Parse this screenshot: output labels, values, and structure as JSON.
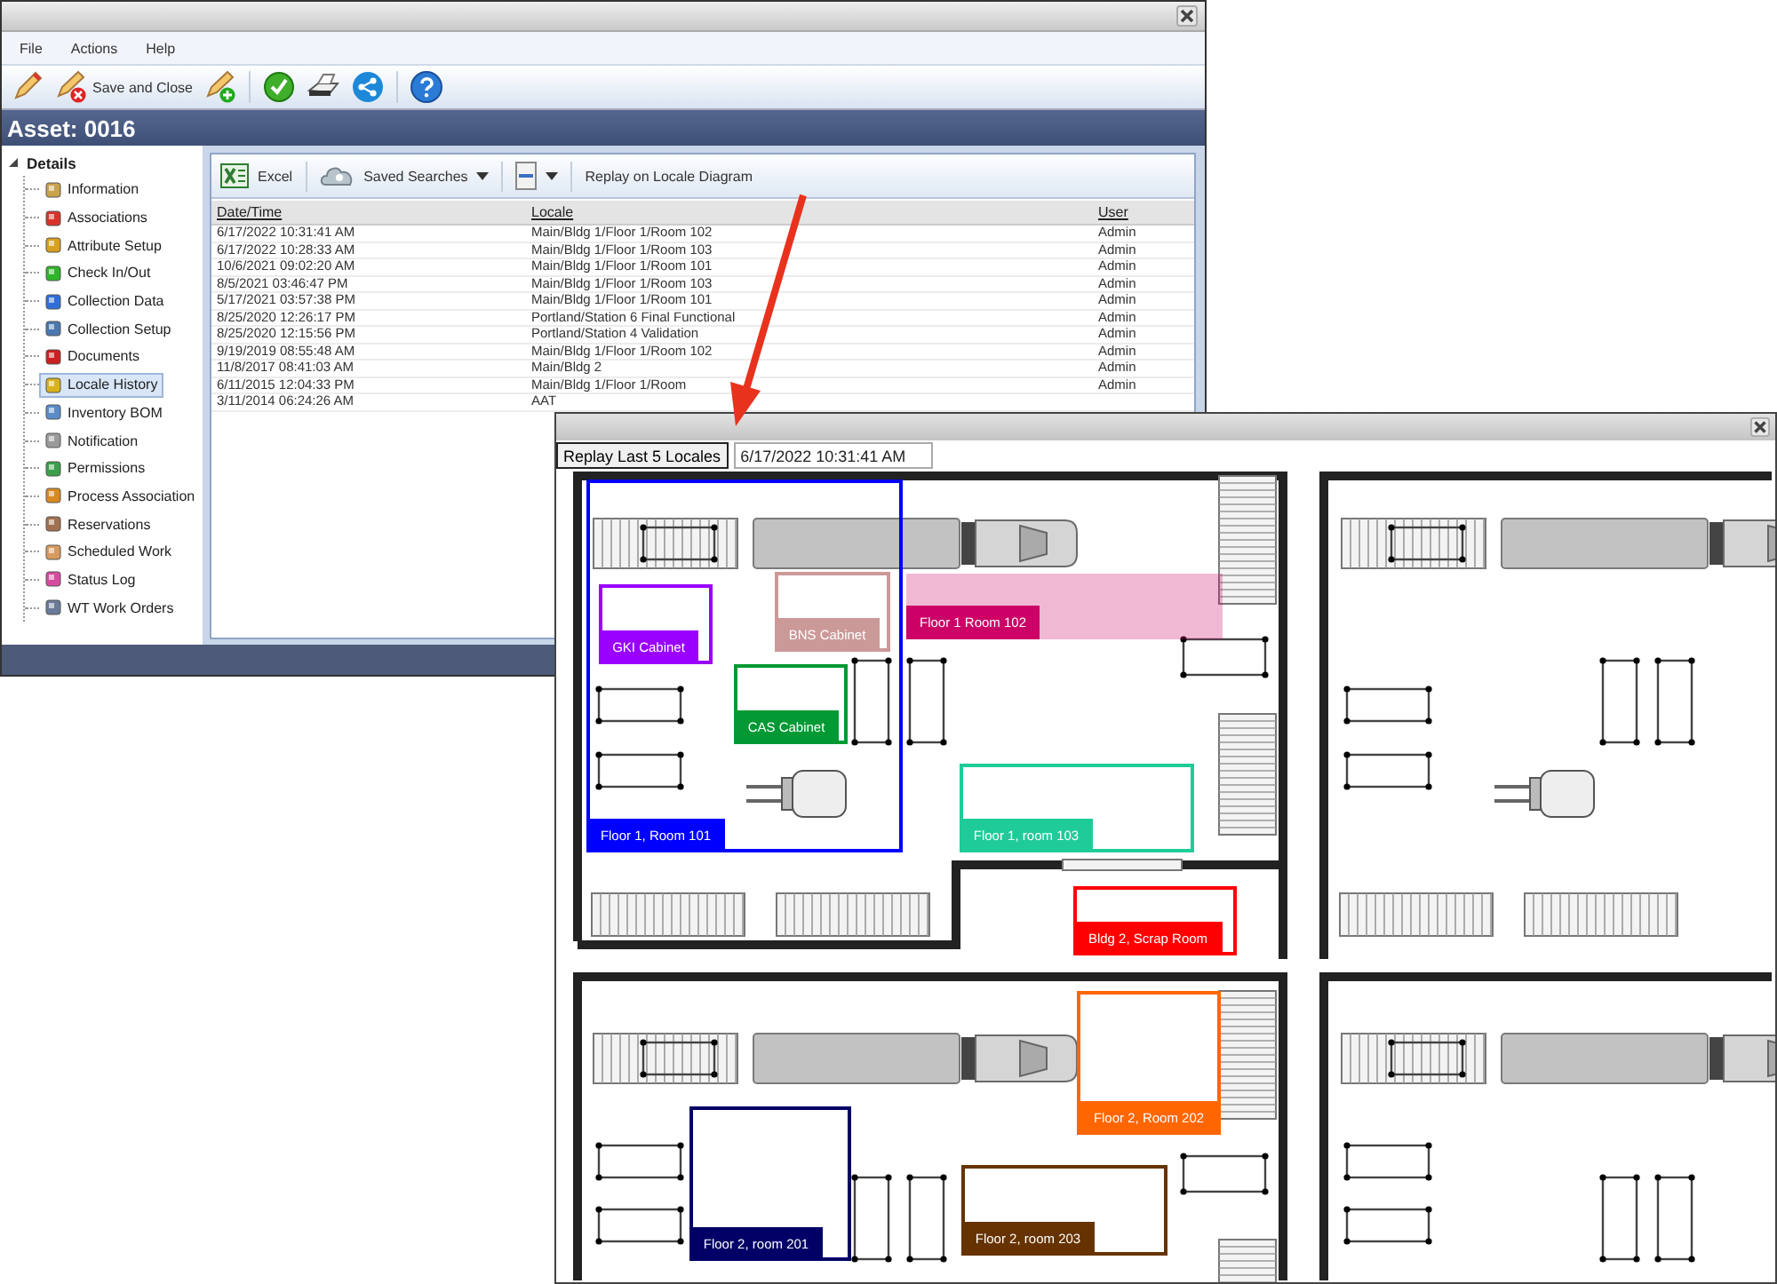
{
  "window": {
    "menu": [
      "File",
      "Actions",
      "Help"
    ],
    "toolbar": [
      {
        "kind": "edit"
      },
      {
        "kind": "save_close",
        "label": "Save and Close"
      },
      {
        "kind": "add"
      },
      {
        "kind": "check"
      },
      {
        "kind": "print"
      },
      {
        "kind": "share"
      },
      {
        "kind": "help"
      }
    ],
    "header": "Asset: 0016"
  },
  "tree": {
    "label": "Details",
    "expanded": true,
    "children": [
      {
        "label": "Information",
        "selected": false
      },
      {
        "label": "Associations",
        "selected": false
      },
      {
        "label": "Attribute Setup",
        "selected": false
      },
      {
        "label": "Check In/Out",
        "selected": false
      },
      {
        "label": "Collection Data",
        "selected": false
      },
      {
        "label": "Collection Setup",
        "selected": false
      },
      {
        "label": "Documents",
        "selected": false
      },
      {
        "label": "Locale History",
        "selected": true
      },
      {
        "label": "Inventory BOM",
        "selected": false
      },
      {
        "label": "Notification",
        "selected": false
      },
      {
        "label": "Permissions",
        "selected": false
      },
      {
        "label": "Process Association",
        "selected": false
      },
      {
        "label": "Reservations",
        "selected": false
      },
      {
        "label": "Scheduled Work",
        "selected": false
      },
      {
        "label": "Status Log",
        "selected": false
      },
      {
        "label": "WT Work Orders",
        "selected": false
      }
    ]
  },
  "grid": {
    "toolbar": [
      {
        "kind": "excel",
        "label": "Excel"
      },
      {
        "kind": "saved_searches",
        "label": "Saved Searches"
      },
      {
        "kind": "columns"
      },
      {
        "kind": "replay",
        "label": "Replay on Locale Diagram"
      }
    ],
    "columns": [
      "Date/Time",
      "Locale",
      "User"
    ],
    "rows": [
      [
        "6/17/2022 10:31:41 AM",
        "Main/Bldg 1/Floor 1/Room 102",
        "Admin"
      ],
      [
        "6/17/2022 10:28:33 AM",
        "Main/Bldg 1/Floor 1/Room 103",
        "Admin"
      ],
      [
        "10/6/2021 09:02:20 AM",
        "Main/Bldg 1/Floor 1/Room 101",
        "Admin"
      ],
      [
        "8/5/2021 03:46:47 PM",
        "Main/Bldg 1/Floor 1/Room 103",
        "Admin"
      ],
      [
        "5/17/2021 03:57:38 PM",
        "Main/Bldg 1/Floor 1/Room 101",
        "Admin"
      ],
      [
        "8/25/2020 12:26:17 PM",
        "Portland/Station 6 Final Functional",
        "Admin"
      ],
      [
        "8/25/2020 12:15:56 PM",
        "Portland/Station 4 Validation",
        "Admin"
      ],
      [
        "9/19/2019 08:55:48 AM",
        "Main/Bldg 1/Floor 1/Room 102",
        "Admin"
      ],
      [
        "11/8/2017 08:41:03 AM",
        "Main/Bldg 2",
        "Admin"
      ],
      [
        "6/11/2015 12:04:33 PM",
        "Main/Bldg 1/Floor 1/Room",
        "Admin"
      ],
      [
        "3/11/2014 06:24:26 AM",
        "AAT"
      ]
    ]
  },
  "dialog": {
    "replay_button": "Replay Last 5 Locales",
    "timestamp": "6/17/2022 10:31:41 AM",
    "locales": [
      {
        "name": "GKI Cabinet",
        "color": "#9900ff",
        "kind": "box"
      },
      {
        "name": "BNS Cabinet",
        "color": "#cc9999",
        "kind": "box"
      },
      {
        "name": "Floor 1 Room 102",
        "color": "#cc0066",
        "kind": "area"
      },
      {
        "name": "Floor 1, Room 101",
        "color": "#0000ff",
        "kind": "box"
      },
      {
        "name": "CAS Cabinet",
        "color": "#009933",
        "kind": "box"
      },
      {
        "name": "Floor 1, room 103",
        "color": "#1fcc99",
        "kind": "box"
      },
      {
        "name": "Bldg 2, Scrap Room",
        "color": "#ff0000",
        "kind": "box"
      },
      {
        "name": "Floor 2, Room 202",
        "color": "#ff6600",
        "kind": "box"
      },
      {
        "name": "Floor 2, room 201",
        "color": "#000066",
        "kind": "box"
      },
      {
        "name": "Floor 2, room 203",
        "color": "#663300",
        "kind": "box"
      }
    ]
  }
}
